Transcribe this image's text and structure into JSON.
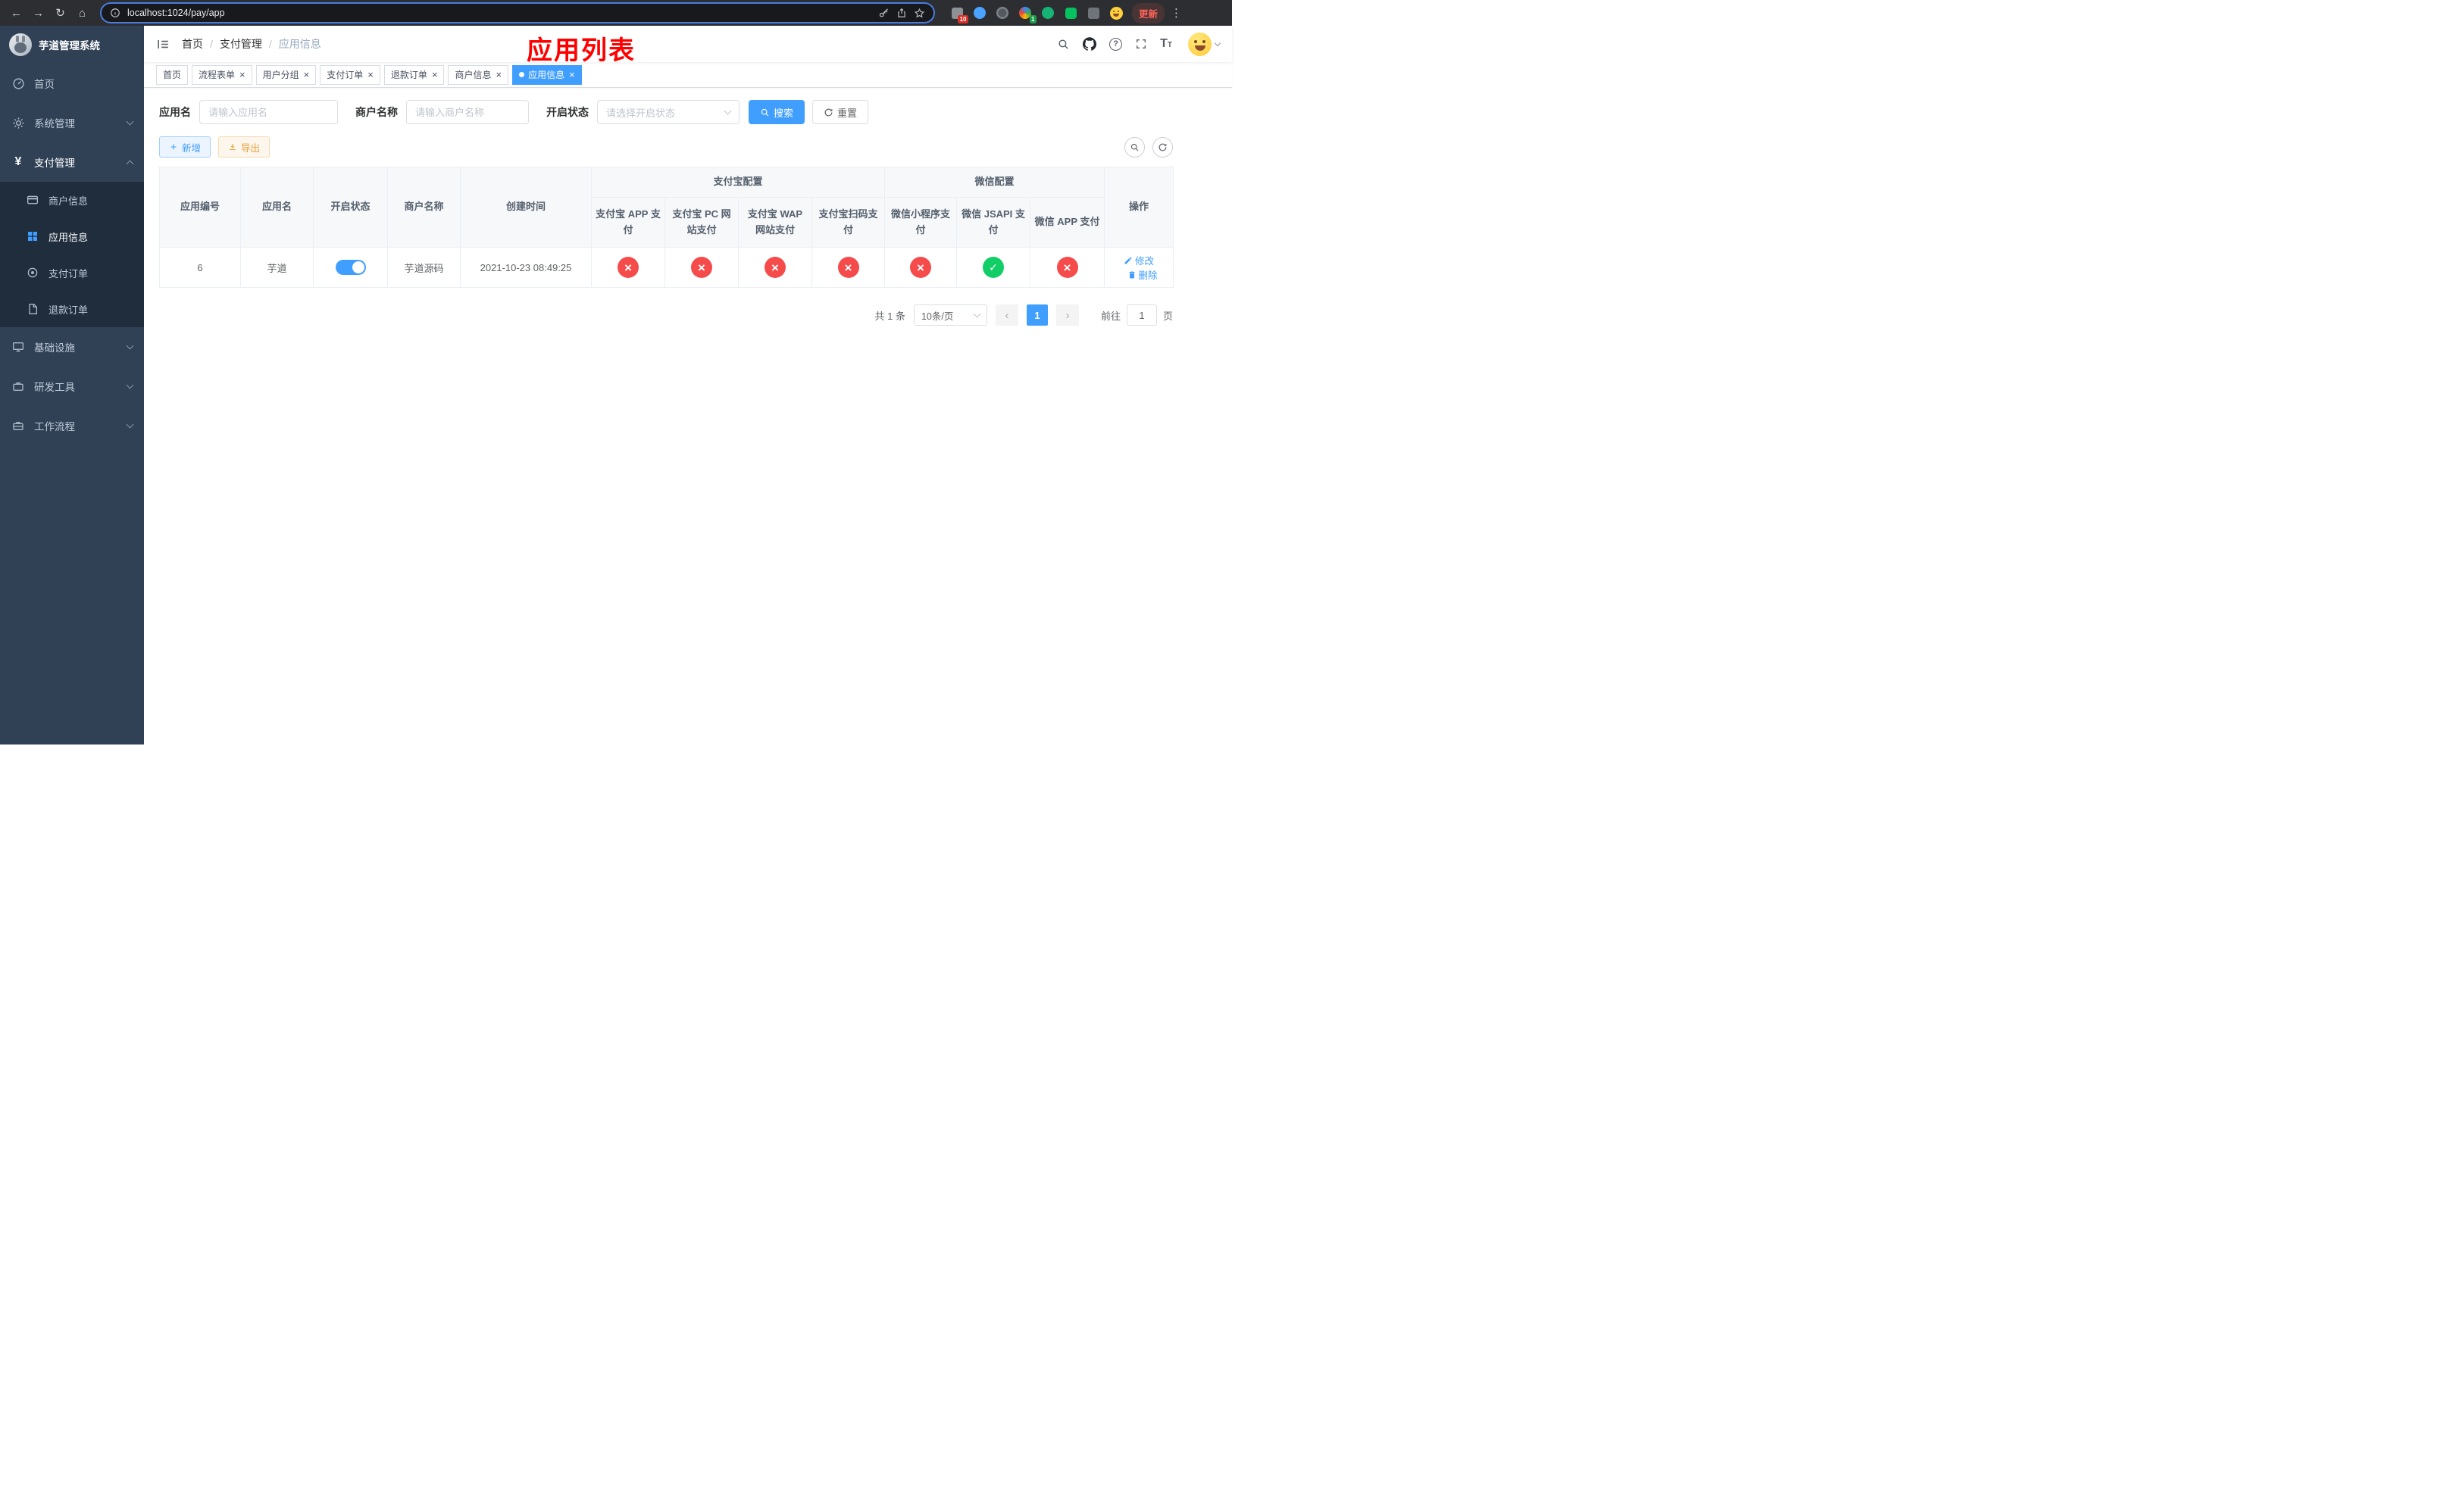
{
  "browser": {
    "url": "localhost:1024/pay/app",
    "update_label": "更新",
    "badge_1": "10",
    "badge_2": "1"
  },
  "icons": {
    "back": "←",
    "forward": "→",
    "reload": "↻",
    "home": "⌂",
    "more": "⋮",
    "close": "×",
    "help": "?",
    "prev": "‹",
    "next": "›",
    "yen": "¥"
  },
  "sidebar": {
    "title": "芋道管理系统",
    "items": [
      {
        "label": "首页"
      },
      {
        "label": "系统管理"
      },
      {
        "label": "支付管理",
        "children": [
          {
            "label": "商户信息"
          },
          {
            "label": "应用信息"
          },
          {
            "label": "支付订单"
          },
          {
            "label": "退款订单"
          }
        ]
      },
      {
        "label": "基础设施"
      },
      {
        "label": "研发工具"
      },
      {
        "label": "工作流程"
      }
    ]
  },
  "header": {
    "breadcrumb": [
      "首页",
      "支付管理",
      "应用信息"
    ],
    "annotation": "应用列表"
  },
  "tabs": [
    {
      "label": "首页"
    },
    {
      "label": "流程表单"
    },
    {
      "label": "用户分组"
    },
    {
      "label": "支付订单"
    },
    {
      "label": "退款订单"
    },
    {
      "label": "商户信息"
    },
    {
      "label": "应用信息"
    }
  ],
  "filters": {
    "app_name": {
      "label": "应用名",
      "placeholder": "请输入应用名",
      "value": ""
    },
    "merchant_name": {
      "label": "商户名称",
      "placeholder": "请输入商户名称",
      "value": ""
    },
    "status": {
      "label": "开启状态",
      "placeholder": "请选择开启状态",
      "value": ""
    },
    "search_button": "搜索",
    "reset_button": "重置"
  },
  "toolbar": {
    "add_button": "新增",
    "export_button": "导出"
  },
  "table": {
    "columns": {
      "id": "应用编号",
      "name": "应用名",
      "status": "开启状态",
      "merchant": "商户名称",
      "created": "创建时间",
      "alipay_group": "支付宝配置",
      "alipay": [
        "支付宝 APP 支付",
        "支付宝 PC 网站支付",
        "支付宝 WAP 网站支付",
        "支付宝扫码支付"
      ],
      "wechat_group": "微信配置",
      "wechat": [
        "微信小程序支付",
        "微信 JSAPI 支付",
        "微信 APP 支付"
      ],
      "actions": "操作"
    },
    "rows": [
      {
        "id": "6",
        "name": "芋道",
        "enabled": "on",
        "merchant": "芋道源码",
        "created": "2021-10-23 08:49:25",
        "alipay_app": "fail",
        "alipay_pc": "fail",
        "alipay_wap": "fail",
        "alipay_qr": "fail",
        "wechat_mini": "fail",
        "wechat_jsapi": "pass",
        "wechat_app": "fail",
        "edit_label": "修改",
        "delete_label": "删除"
      }
    ]
  },
  "pagination": {
    "total": "共 1 条",
    "page_size": "10条/页",
    "page": "1",
    "goto_label": "前往",
    "goto_value": "1",
    "page_unit": "页"
  },
  "colors": {
    "accent": "#409EFF",
    "danger": "#F54B4B",
    "success": "#13CE66",
    "warning": "#E6A23C",
    "annotation_red": "#FF0000",
    "sidebar_bg": "#304156",
    "submenu_bg": "#1F2D3D",
    "active_tab_bg": "#409EFF"
  }
}
